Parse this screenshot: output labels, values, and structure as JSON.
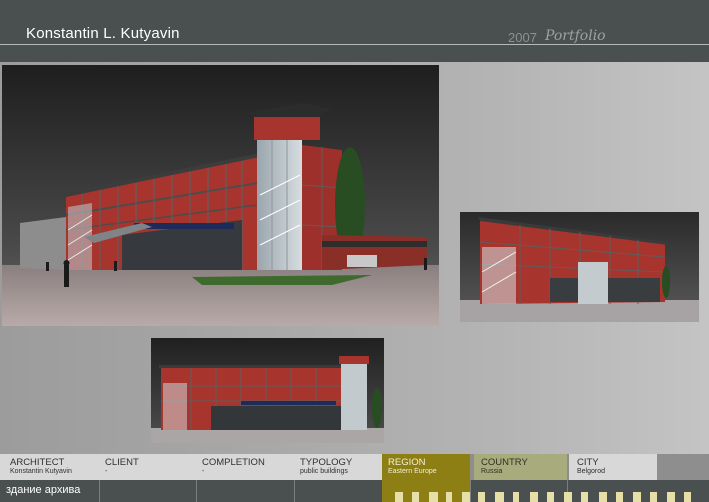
{
  "header": {
    "name": "Konstantin L. Kutyavin",
    "year": "2007",
    "portfolio": "Portfolio"
  },
  "images": {
    "main": "perspective-render",
    "side": "side-elevation-render",
    "front": "front-elevation-render"
  },
  "footer": {
    "architect_label": "ARCHITECT",
    "architect_value": "Konstantin Kutyavin",
    "client_label": "CLIENT",
    "client_value": "-",
    "completion_label": "COMPLETION",
    "completion_value": "-",
    "typology_label": "TYPOLOGY",
    "typology_value": "public buildings",
    "region_label": "REGION",
    "region_value": "Eastern Europe",
    "country_label": "COUNTRY",
    "country_value": "Russia",
    "city_label": "CITY",
    "city_value": "Belgorod",
    "caption": "здание архива"
  },
  "colors": {
    "header": "#4a4f4f",
    "region": "#8d7f14",
    "country": "#a8ac7c",
    "brick": "#b23a34"
  }
}
